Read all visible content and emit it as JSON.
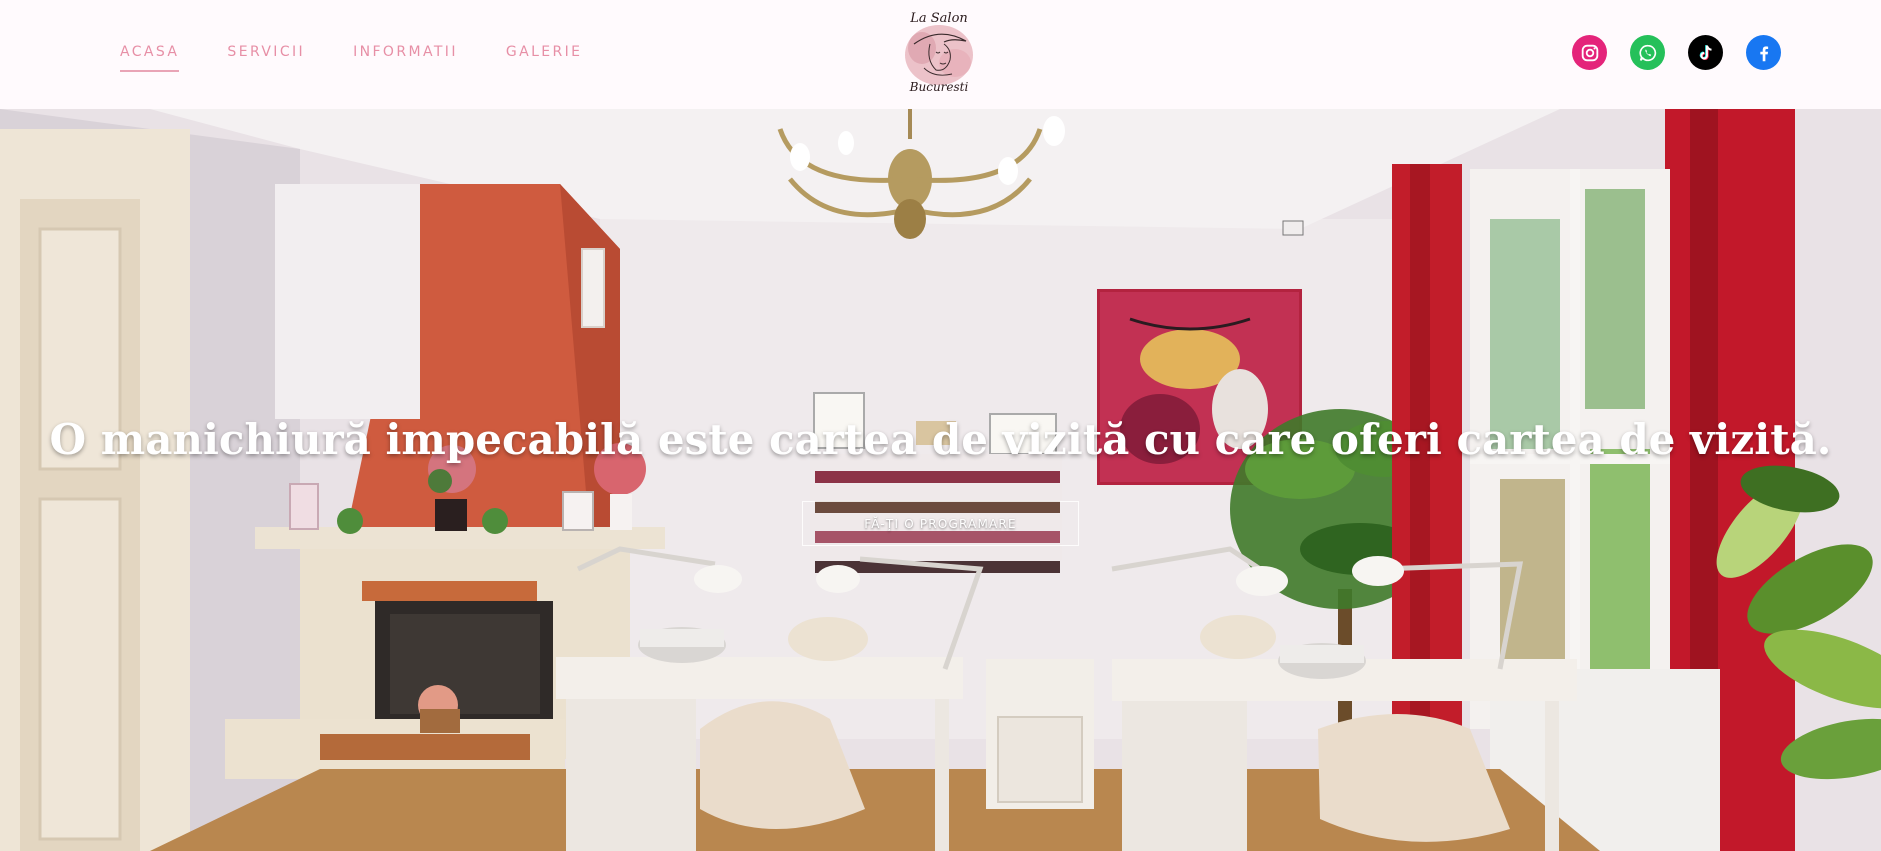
{
  "nav": {
    "items": [
      {
        "label": "ACASA",
        "active": true
      },
      {
        "label": "SERVICII",
        "active": false
      },
      {
        "label": "INFORMATII",
        "active": false
      },
      {
        "label": "GALERIE",
        "active": false
      }
    ]
  },
  "logo": {
    "line1": "La Salon",
    "line2": "Bucuresti"
  },
  "socials": [
    {
      "name": "instagram-icon",
      "color": "#e4247a"
    },
    {
      "name": "whatsapp-icon",
      "color": "#25c05a"
    },
    {
      "name": "tiktok-icon",
      "color": "#000000"
    },
    {
      "name": "facebook-icon",
      "color": "#1877f2"
    }
  ],
  "hero": {
    "title": "O manichiură impecabilă este cartea de vizită cu care oferi cartea de vizită.",
    "cta_label": "FĂ-ȚI O PROGRAMARE"
  },
  "colors": {
    "accent": "#e78fa6",
    "header_bg": "#fffafd"
  }
}
